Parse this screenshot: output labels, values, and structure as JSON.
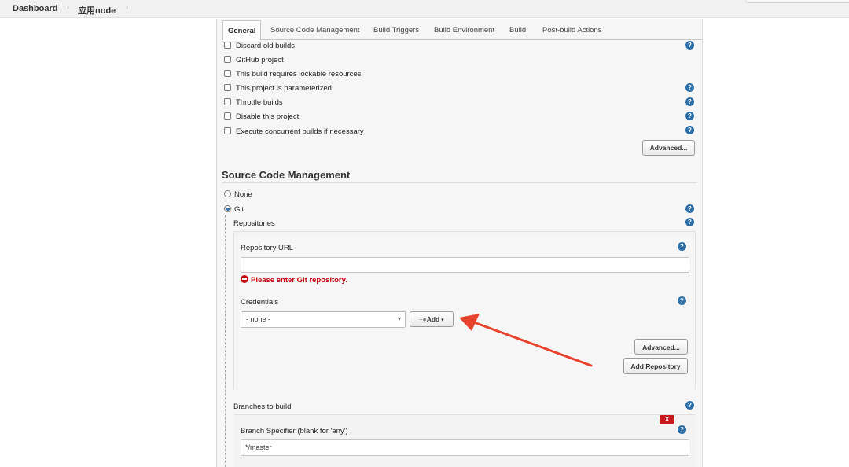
{
  "breadcrumb": {
    "items": [
      "Dashboard",
      "应用node"
    ],
    "separator": "›"
  },
  "tabs": [
    {
      "label": "General",
      "active": true
    },
    {
      "label": "Source Code Management"
    },
    {
      "label": "Build Triggers"
    },
    {
      "label": "Build Environment"
    },
    {
      "label": "Build"
    },
    {
      "label": "Post-build Actions"
    }
  ],
  "general": {
    "options": [
      {
        "label": "Discard old builds",
        "checked": false
      },
      {
        "label": "GitHub project",
        "checked": false
      },
      {
        "label": "This build requires lockable resources",
        "checked": false
      },
      {
        "label": "This project is parameterized",
        "checked": false
      },
      {
        "label": "Throttle builds",
        "checked": false
      },
      {
        "label": "Disable this project",
        "checked": false
      },
      {
        "label": "Execute concurrent builds if necessary",
        "checked": false
      }
    ],
    "advanced_label": "Advanced..."
  },
  "scm": {
    "title": "Source Code Management",
    "options": [
      {
        "label": "None",
        "selected": false
      },
      {
        "label": "Git",
        "selected": true
      }
    ],
    "repositories_label": "Repositories",
    "repo_url_label": "Repository URL",
    "repo_url_value": "",
    "repo_error": "Please enter Git repository.",
    "credentials_label": "Credentials",
    "credentials_value": "- none -",
    "add_label": "Add",
    "advanced_label": "Advanced...",
    "add_repository_label": "Add Repository",
    "branches_label": "Branches to build",
    "branch_delete_label": "X",
    "branch_spec_label": "Branch Specifier (blank for 'any')",
    "branch_spec_value": "*/master"
  },
  "help_glyph": "?",
  "colors": {
    "help": "#2d6fa8",
    "error": "#c4000a",
    "annotation_arrow": "#e8412c",
    "delete": "#c8191f"
  }
}
